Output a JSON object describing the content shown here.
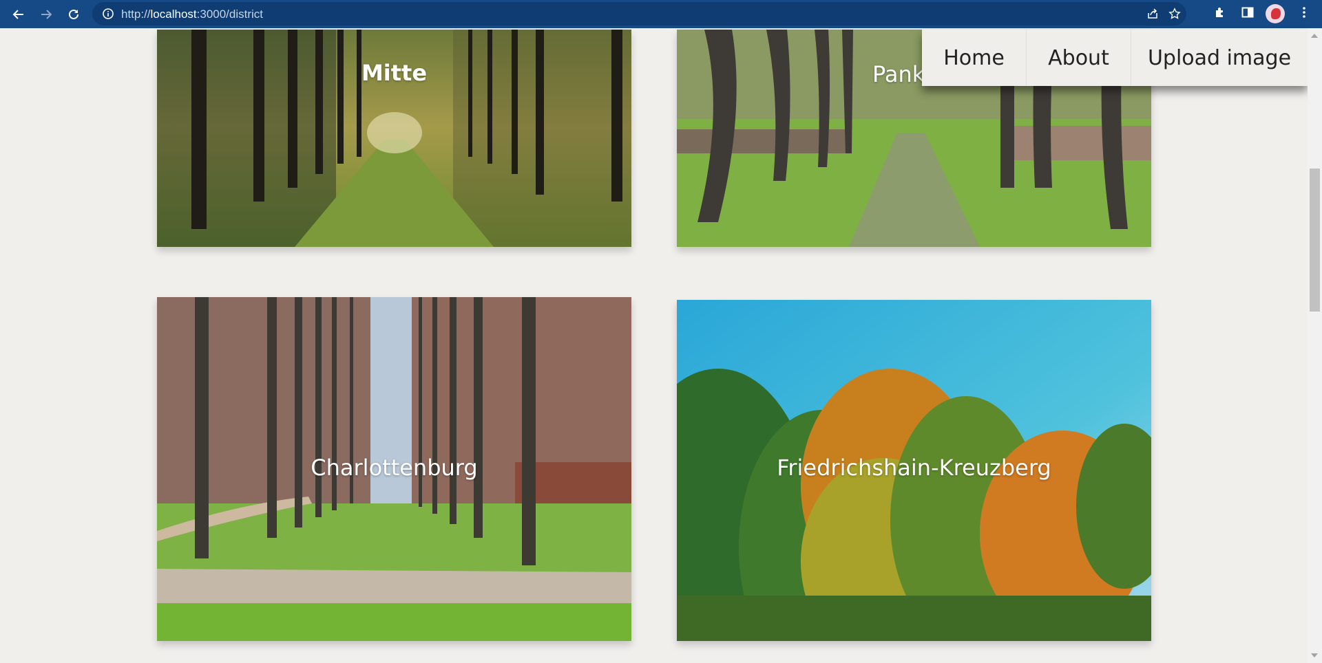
{
  "browser": {
    "url_prefix": "http://",
    "url_host": "localhost",
    "url_rest": ":3000/district",
    "icons": [
      "back-icon",
      "forward-icon",
      "reload-icon",
      "info-icon",
      "share-icon",
      "star-icon",
      "extensions-icon",
      "side-panel-icon",
      "avatar",
      "menu-icon"
    ]
  },
  "nav": {
    "items": [
      {
        "label": "Home"
      },
      {
        "label": "About"
      },
      {
        "label": "Upload image"
      }
    ]
  },
  "districts": [
    {
      "name": "Mitte"
    },
    {
      "name": "Pankow"
    },
    {
      "name": "Charlottenburg"
    },
    {
      "name": "Friedrichshain-Kreuzberg"
    }
  ],
  "colors": {
    "chrome": "#154a87",
    "page_bg": "#f0efec",
    "nav_bg": "#efeeb"
  }
}
